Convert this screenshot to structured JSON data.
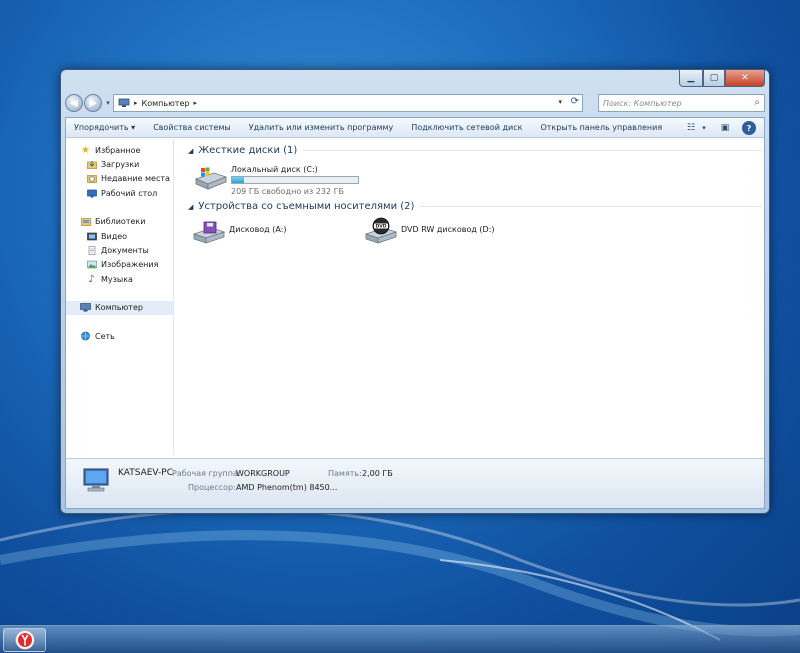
{
  "window": {
    "address": {
      "crumb": "Компьютер"
    },
    "search": {
      "placeholder": "Поиск: Компьютер"
    }
  },
  "toolbar": {
    "organize": "Упорядочить",
    "system_properties": "Свойства системы",
    "uninstall": "Удалить или изменить программу",
    "map_drive": "Подключить сетевой диск",
    "control_panel": "Открыть панель управления"
  },
  "sidebar": {
    "favorites": {
      "label": "Избранное",
      "items": [
        {
          "label": "Загрузки",
          "icon": "downloads-icon"
        },
        {
          "label": "Недавние места",
          "icon": "recent-places-icon"
        },
        {
          "label": "Рабочий стол",
          "icon": "desktop-icon"
        }
      ]
    },
    "libraries": {
      "label": "Библиотеки",
      "items": [
        {
          "label": "Видео",
          "icon": "video-icon"
        },
        {
          "label": "Документы",
          "icon": "documents-icon"
        },
        {
          "label": "Изображения",
          "icon": "pictures-icon"
        },
        {
          "label": "Музыка",
          "icon": "music-icon"
        }
      ]
    },
    "computer": {
      "label": "Компьютер"
    },
    "network": {
      "label": "Сеть"
    }
  },
  "groups": {
    "hard_disks": {
      "title": "Жесткие диски (1)",
      "drives": [
        {
          "label": "Локальный диск (C:)",
          "free": "209 ГБ свободно из 232 ГБ",
          "used_fraction": 0.099
        }
      ]
    },
    "removable": {
      "title": "Устройства со съемными носителями (2)",
      "drives": [
        {
          "label": "Дисковод (A:)"
        },
        {
          "label": "DVD RW дисковод (D:)"
        }
      ]
    }
  },
  "details": {
    "pc_name": "KATSAEV-PC",
    "workgroup_key": "Рабочая группа:",
    "workgroup_value": "WORKGROUP",
    "memory_key": "Память:",
    "memory_value": "2,00 ГБ",
    "cpu_key": "Процессор:",
    "cpu_value": "AMD Phenom(tm) 8450..."
  },
  "colors": {
    "accent": "#1e395b",
    "progress_fill": "#25a5d8"
  }
}
